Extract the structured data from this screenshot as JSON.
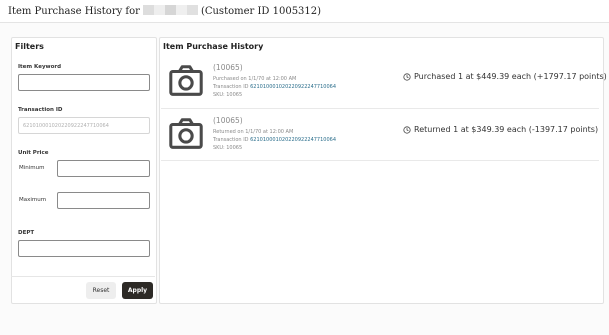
{
  "header": {
    "title_prefix": "Item Purchase History for",
    "title_suffix": "(Customer ID 1005312)"
  },
  "filters": {
    "title": "Filters",
    "keyword_label": "Item Keyword",
    "keyword_value": "",
    "transaction_label": "Transaction ID",
    "transaction_value": "621010001020220922247710064",
    "unit_price_label": "Unit Price",
    "minimum_label": "Minimum",
    "maximum_label": "Maximum",
    "dept_label": "DEPT",
    "reset_label": "Reset",
    "apply_label": "Apply"
  },
  "history": {
    "title": "Item Purchase History",
    "items": [
      {
        "item_id": "(10065)",
        "date_line": "Purchased on 1/1/70 at 12:00 AM",
        "txn_label": "Transaction ID",
        "txn_value": "621010001020220922247710064",
        "sku": "SKU: 10065",
        "summary": "Purchased 1 at $449.39 each (+1797.17 points)"
      },
      {
        "item_id": "(10065)",
        "date_line": "Returned on 1/1/70 at 12:00 AM",
        "txn_label": "Transaction ID",
        "txn_value": "621010001020220922247710064",
        "sku": "SKU: 10065",
        "summary": "Returned 1 at $349.39 each (-1397.17 points)"
      }
    ]
  },
  "icons": {
    "item_image": "camera-icon",
    "status": "clock-icon"
  }
}
